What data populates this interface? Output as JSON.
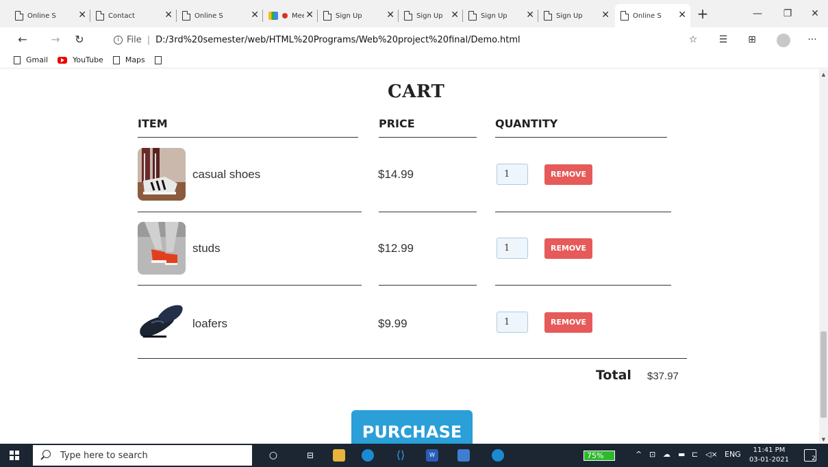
{
  "browser": {
    "tabs": [
      {
        "label": "Online Sh",
        "icon": "page-icon",
        "active": false
      },
      {
        "label": "Contact U",
        "icon": "page-icon",
        "active": false
      },
      {
        "label": "Online Sh",
        "icon": "page-icon",
        "active": false
      },
      {
        "label": "Meet",
        "icon": "meet-icon",
        "active": false
      },
      {
        "label": "Sign Up F",
        "icon": "page-icon",
        "active": false
      },
      {
        "label": "Sign Up F",
        "icon": "page-icon",
        "active": false
      },
      {
        "label": "Sign Up F",
        "icon": "page-icon",
        "active": false
      },
      {
        "label": "Sign Up F",
        "icon": "page-icon",
        "active": false
      },
      {
        "label": "Online Sh",
        "icon": "page-icon",
        "active": true
      }
    ],
    "address": {
      "scheme": "File",
      "url": "D:/3rd%20semester/web/HTML%20Programs/Web%20project%20final/Demo.html"
    },
    "bookmarks": [
      {
        "label": "Gmail",
        "icon": "page-icon"
      },
      {
        "label": "YouTube",
        "icon": "youtube-icon"
      },
      {
        "label": "Maps",
        "icon": "page-icon"
      },
      {
        "label": "",
        "icon": "page-icon"
      }
    ]
  },
  "cart": {
    "title": "CART",
    "columns": {
      "item": "ITEM",
      "price": "PRICE",
      "quantity": "QUANTITY"
    },
    "items": [
      {
        "name": "casual shoes",
        "price": "$14.99",
        "quantity": "1",
        "remove_label": "REMOVE"
      },
      {
        "name": "studs",
        "price": "$12.99",
        "quantity": "1",
        "remove_label": "REMOVE"
      },
      {
        "name": "loafers",
        "price": "$9.99",
        "quantity": "1",
        "remove_label": "REMOVE"
      }
    ],
    "total_label": "Total",
    "total_value": "$37.97",
    "purchase_label": "PURCHASE"
  },
  "taskbar": {
    "search_placeholder": "Type here to search",
    "battery": "75%",
    "language": "ENG",
    "time": "11:41 PM",
    "date": "03-01-2021",
    "notification_count": "2"
  },
  "colors": {
    "remove_button": "#e65a5a",
    "purchase_button": "#2a9fd8",
    "taskbar": "#1c2532"
  }
}
